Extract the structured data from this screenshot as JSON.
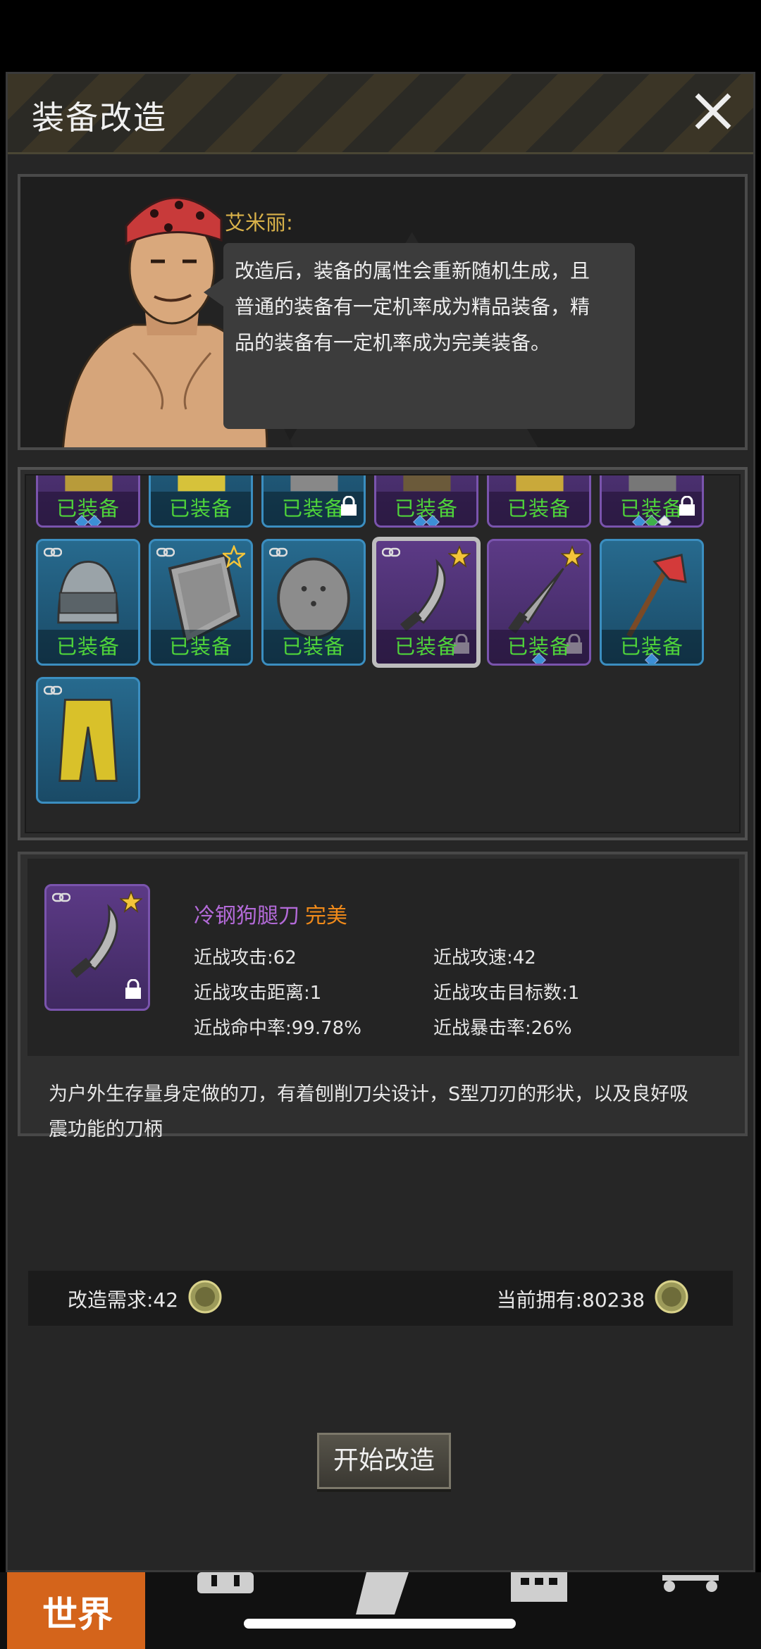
{
  "dialog": {
    "title": "装备改造"
  },
  "npc": {
    "name": "艾米丽:",
    "dialogue_lines": [
      "改造后，装备的属性会重新随机生成，且",
      "普通的装备有一定机率成为精品装备，精",
      "品的装备有一定机率成为完美装备。"
    ]
  },
  "inventory": {
    "equipped_label": "已装备",
    "row1": [
      {
        "icon": "boots-icon",
        "color": "purple",
        "locked": false,
        "gems": [
          "blue",
          "blue"
        ]
      },
      {
        "icon": "gloves-icon",
        "color": "blue",
        "locked": false,
        "gems": []
      },
      {
        "icon": "gear-icon",
        "color": "blue",
        "locked": true,
        "gems": []
      },
      {
        "icon": "armor-icon",
        "color": "purple",
        "locked": false,
        "gems": [
          "blue",
          "blue"
        ]
      },
      {
        "icon": "gloves-icon",
        "color": "purple",
        "locked": false,
        "gems": []
      },
      {
        "icon": "helmet-icon",
        "color": "purple",
        "locked": true,
        "gems": [
          "blue",
          "green",
          "white"
        ]
      }
    ],
    "row2": [
      {
        "icon": "helmet-icon",
        "color": "blue",
        "linked": true,
        "star": false,
        "locked": false,
        "label": "已装备"
      },
      {
        "icon": "shield-icon",
        "color": "blue",
        "linked": true,
        "star": true,
        "locked": false,
        "label": "已装备"
      },
      {
        "icon": "round-shield-icon",
        "color": "blue",
        "linked": true,
        "star": false,
        "locked": false,
        "label": "已装备"
      },
      {
        "icon": "machete-icon",
        "color": "purple",
        "linked": true,
        "star": true,
        "locked": true,
        "selected": true,
        "label": "已装备"
      },
      {
        "icon": "knife-icon",
        "color": "purple",
        "linked": false,
        "star": true,
        "locked": true,
        "label": "已装备",
        "gems": [
          "blue"
        ]
      },
      {
        "icon": "fire-axe-icon",
        "color": "blue",
        "linked": false,
        "star": false,
        "locked": false,
        "label": "已装备",
        "gems": [
          "blue"
        ]
      }
    ],
    "row3": [
      {
        "icon": "pants-icon",
        "color": "blue",
        "linked": true
      }
    ]
  },
  "selected_item": {
    "name": "冷钢狗腿刀",
    "quality": "完美",
    "stats": {
      "melee_attack": "近战攻击:62",
      "melee_speed": "近战攻速:42",
      "melee_range": "近战攻击距离:1",
      "melee_targets": "近战攻击目标数:1",
      "melee_hit": "近战命中率:99.78%",
      "melee_crit": "近战暴击率:26%"
    },
    "description_lines": [
      "为户外生存量身定做的刀，有着刨削刀尖设计，S型刀刃的形状，以及良好吸",
      "震功能的刀柄"
    ]
  },
  "cost": {
    "required": "改造需求:42",
    "owned": "当前拥有:80238"
  },
  "start_button": "开始改造",
  "bottom_nav": {
    "world": "世界"
  },
  "colors": {
    "equipped_text": "#4fd43a",
    "item_name": "#b36ad8",
    "quality_perfect": "#f08a1a",
    "speaker": "#d9b24a",
    "blue_slot": "#276a8e",
    "purple_slot": "#5c3a86"
  }
}
